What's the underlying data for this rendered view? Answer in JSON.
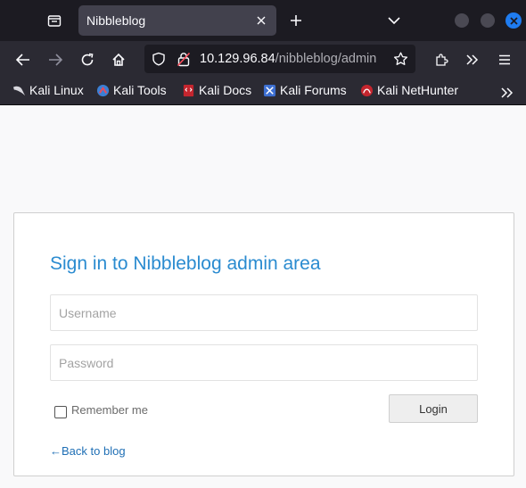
{
  "browser": {
    "tab": {
      "title": "Nibbleblog"
    },
    "url": {
      "host": "10.129.96.84",
      "path": "/nibbleblog/admin"
    },
    "bookmarks": [
      {
        "label": "Kali Linux",
        "icon": "kali-dragon-icon"
      },
      {
        "label": "Kali Tools",
        "icon": "kali-tools-icon"
      },
      {
        "label": "Kali Docs",
        "icon": "kali-docs-icon"
      },
      {
        "label": "Kali Forums",
        "icon": "kali-forums-icon"
      },
      {
        "label": "Kali NetHunter",
        "icon": "kali-nethunter-icon"
      }
    ]
  },
  "login": {
    "title": "Sign in to Nibbleblog admin area",
    "username_placeholder": "Username",
    "password_placeholder": "Password",
    "remember_label": "Remember me",
    "login_button": "Login",
    "back_link": "←Back to blog"
  },
  "colors": {
    "title_blue": "#2a8bd0",
    "link_blue": "#1f6fb5",
    "chrome_dark": "#1c1b22",
    "toolbar": "#2b2a33",
    "accent_close": "#1f7cf0"
  }
}
